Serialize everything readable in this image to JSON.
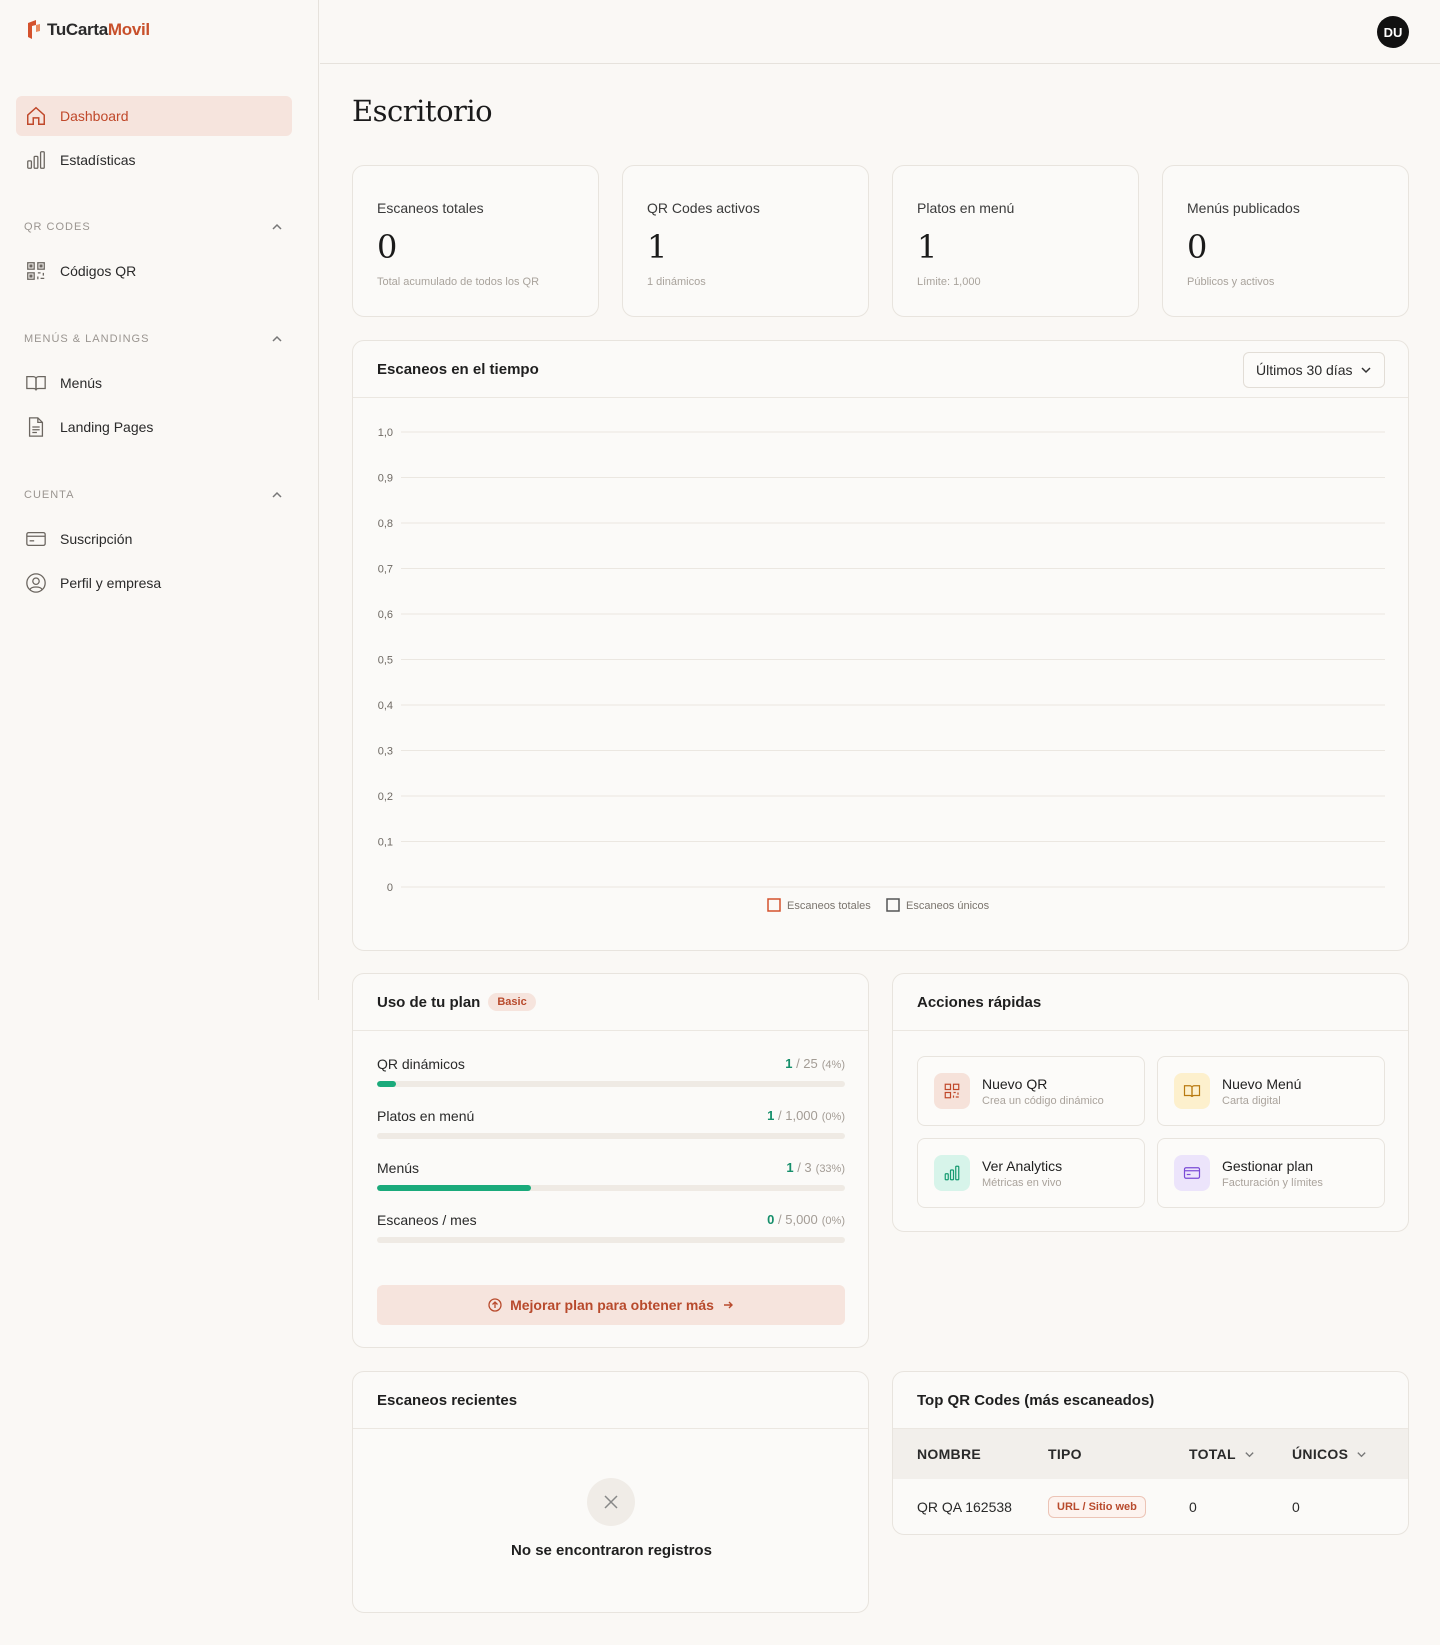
{
  "app": {
    "brand_part1": "Tu",
    "brand_part2": "Carta",
    "brand_part3": "Movil",
    "avatar_initials": "DU"
  },
  "sidebar": {
    "dashboard": "Dashboard",
    "stats": "Estadísticas",
    "section_qr": "QR CODES",
    "qr_codes": "Códigos QR",
    "section_menus": "MENÚS & LANDINGS",
    "menus": "Menús",
    "landing": "Landing Pages",
    "section_account": "CUENTA",
    "subscription": "Suscripción",
    "profile": "Perfil y empresa"
  },
  "page": {
    "title": "Escritorio"
  },
  "stats": [
    {
      "label": "Escaneos totales",
      "value": "0",
      "sub": "Total acumulado de todos los QR"
    },
    {
      "label": "QR Codes activos",
      "value": "1",
      "sub": "1 dinámicos"
    },
    {
      "label": "Platos en menú",
      "value": "1",
      "sub": "Límite: 1,000"
    },
    {
      "label": "Menús publicados",
      "value": "0",
      "sub": "Públicos y activos"
    }
  ],
  "chart_panel": {
    "title": "Escaneos en el tiempo",
    "range": "Últimos 30 días"
  },
  "chart_data": {
    "type": "line",
    "title": "",
    "xlabel": "",
    "ylabel": "",
    "ylim": [
      0,
      1
    ],
    "y_ticks": [
      "0",
      "0,1",
      "0,2",
      "0,3",
      "0,4",
      "0,5",
      "0,6",
      "0,7",
      "0,8",
      "0,9",
      "1,0"
    ],
    "series": [
      {
        "name": "Escaneos totales",
        "values": [],
        "color": "#d4522d"
      },
      {
        "name": "Escaneos únicos",
        "values": [],
        "color": "#555555"
      }
    ],
    "legend": "bottom-center",
    "grid": true
  },
  "usage": {
    "title": "Uso de tu plan",
    "badge": "Basic",
    "rows": [
      {
        "label": "QR dinámicos",
        "current": "1",
        "limit": "/ 25",
        "pct": "(4%)",
        "fill": 0.04
      },
      {
        "label": "Platos en menú",
        "current": "1",
        "limit": "/ 1,000",
        "pct": "(0%)",
        "fill": 0.0
      },
      {
        "label": "Menús",
        "current": "1",
        "limit": "/ 3",
        "pct": "(33%)",
        "fill": 0.33
      },
      {
        "label": "Escaneos / mes",
        "current": "0",
        "limit": "/ 5,000",
        "pct": "(0%)",
        "fill": 0.0
      }
    ],
    "upgrade": "Mejorar plan para obtener más"
  },
  "quick": {
    "title": "Acciones rápidas",
    "items": [
      {
        "title": "Nuevo QR",
        "sub": "Crea un código dinámico"
      },
      {
        "title": "Nuevo Menú",
        "sub": "Carta digital"
      },
      {
        "title": "Ver Analytics",
        "sub": "Métricas en vivo"
      },
      {
        "title": "Gestionar plan",
        "sub": "Facturación y límites"
      }
    ]
  },
  "recent": {
    "title": "Escaneos recientes",
    "empty": "No se encontraron registros"
  },
  "top": {
    "title": "Top QR Codes (más escaneados)",
    "headers": [
      "NOMBRE",
      "TIPO",
      "TOTAL",
      "ÚNICOS"
    ],
    "rows": [
      {
        "name": "QR QA 162538",
        "type": "URL / Sitio web",
        "total": "0",
        "unique": "0"
      }
    ]
  }
}
